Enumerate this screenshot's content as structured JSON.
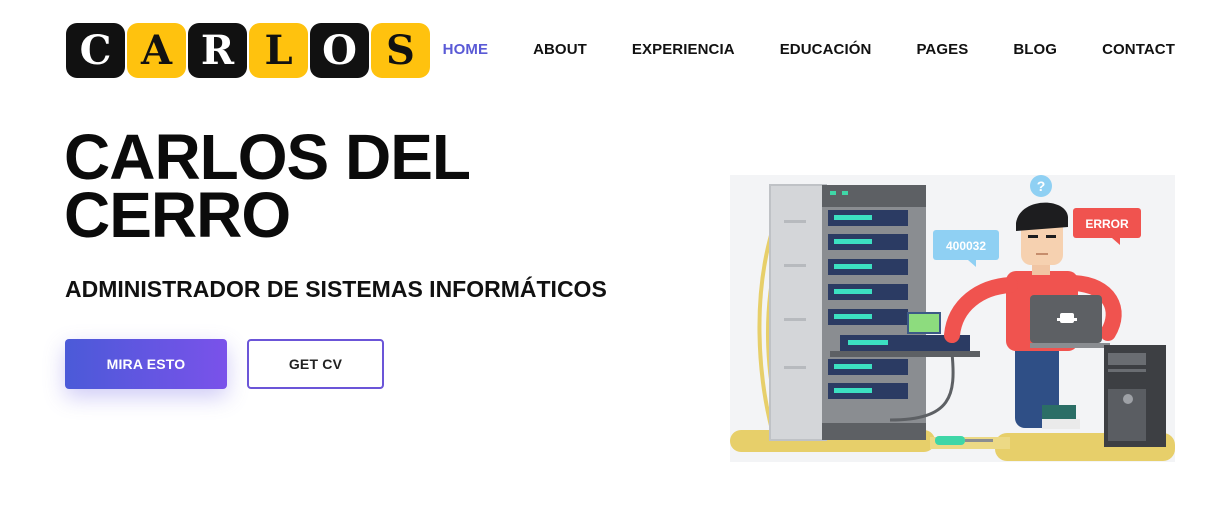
{
  "logo": {
    "letters": [
      "C",
      "A",
      "R",
      "L",
      "O",
      "S"
    ],
    "colors": {
      "dark": "#111111",
      "gold": "#ffc20e"
    }
  },
  "nav": {
    "items": [
      "HOME",
      "ABOUT",
      "EXPERIENCIA",
      "EDUCACIÓN",
      "PAGES",
      "BLOG",
      "CONTACT"
    ],
    "active_color": "#5a5ad6"
  },
  "hero": {
    "name_line1": "CARLOS DEL",
    "name_line2": "CERRO",
    "subtitle": "ADMINISTRADOR DE SISTEMAS INFORMÁTICOS",
    "primary_button": "MIRA ESTO",
    "secondary_button": "GET CV"
  },
  "illustration": {
    "bubble_code": "400032",
    "bubble_error": "ERROR",
    "question_mark": "?",
    "icons": [
      "server-rack-icon",
      "laptop-icon",
      "pc-tower-icon",
      "screwdriver-icon",
      "network-switch-icon"
    ]
  },
  "theme": {
    "accent_start": "#4b5ad8",
    "accent_end": "#7a52ea"
  }
}
